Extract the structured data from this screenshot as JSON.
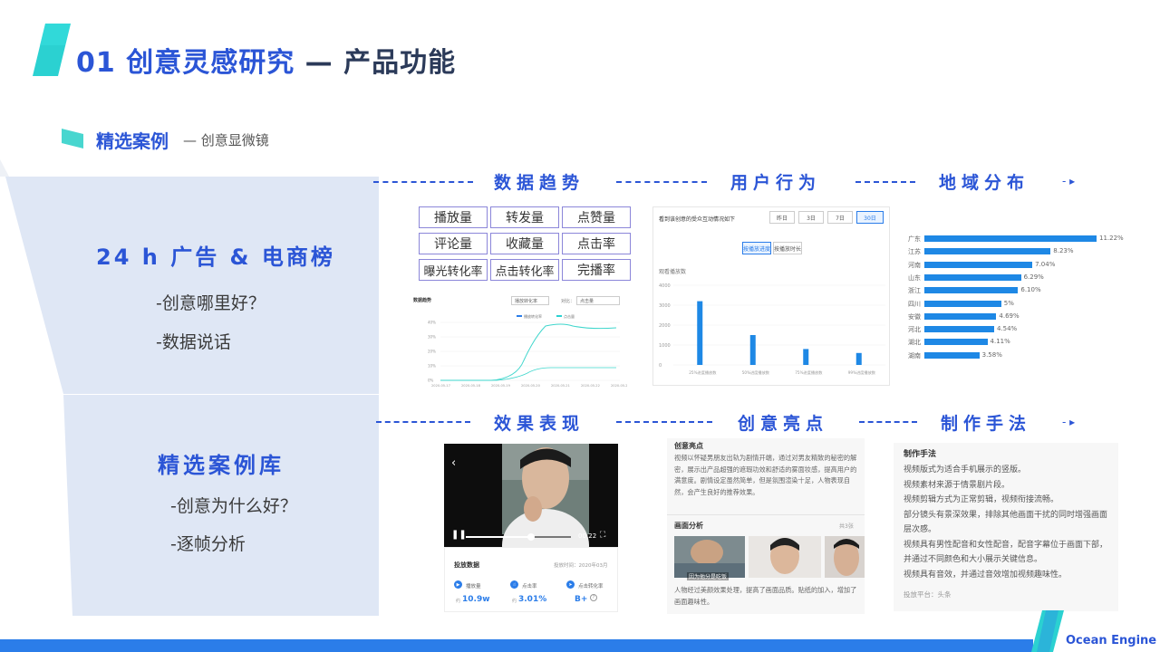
{
  "header": {
    "title_main": "01 创意灵感研究",
    "title_dash": " — ",
    "title_tail": "产品功能"
  },
  "section": {
    "title": "精选案例",
    "subtitle": "— 创意显微镜"
  },
  "left_panels": [
    {
      "title": "24 h 广告 & 电商榜",
      "items": [
        "-创意哪里好？",
        "-数据说话"
      ]
    },
    {
      "title": "精选案例库",
      "items": [
        "-创意为什么好？",
        "-逐帧分析"
      ]
    }
  ],
  "section_heads": {
    "data_trend": "数据趋势",
    "user_behavior": "用户行为",
    "region": "地域分布",
    "effect": "效果表现",
    "highlight": "创意亮点",
    "technique": "制作手法"
  },
  "metrics": [
    "播放量",
    "转发量",
    "点赞量",
    "评论量",
    "收藏量",
    "点击率",
    "曝光转化率",
    "点击转化率",
    "完播率"
  ],
  "trend_chart": {
    "title": "数据趋势",
    "select1": "播放转化率",
    "select2_label": "对比：",
    "select2": "点击量",
    "legend": [
      "播放转化率",
      "点击量"
    ],
    "yticks": [
      "40%",
      "30%",
      "20%",
      "10%",
      "0%"
    ],
    "xticks": [
      "2020-05-17",
      "2020-05-18",
      "2020-05-19",
      "2020-05-20",
      "2020-05-21",
      "2020-05-22",
      "2020-05-23"
    ]
  },
  "behavior_chart": {
    "title": "看到该创意的受众互动情况如下",
    "ranges": [
      "昨日",
      "3日",
      "7日",
      "30日"
    ],
    "active_range": "30日",
    "toggles": [
      "按播放进度",
      "按播放时长"
    ],
    "ylabel": "观看播放数",
    "yticks": [
      "4000",
      "3000",
      "2000",
      "1000",
      "0"
    ],
    "categories": [
      "25%进度播放数",
      "50%进度播放数",
      "75%进度播放数",
      "99%进度播放数"
    ],
    "values": [
      3200,
      1500,
      800,
      600
    ]
  },
  "region_chart": {
    "provinces": [
      "广东",
      "江苏",
      "河南",
      "山东",
      "浙江",
      "四川",
      "安徽",
      "河北",
      "湖北",
      "湖南"
    ],
    "values": [
      "11.22%",
      "8.23%",
      "7.04%",
      "6.29%",
      "6.10%",
      "5%",
      "4.69%",
      "4.54%",
      "4.11%",
      "3.58%"
    ],
    "fractions": [
      1.0,
      0.733,
      0.627,
      0.561,
      0.544,
      0.446,
      0.418,
      0.405,
      0.366,
      0.319
    ]
  },
  "video": {
    "time": "00:22",
    "data_title": "投放数据",
    "data_date": "投放时间：2020年03月",
    "stats": [
      {
        "label": "播放量",
        "prefix": "约",
        "value": "10.9w"
      },
      {
        "label": "点击率",
        "prefix": "约",
        "value": "3.01%"
      },
      {
        "label": "点击转化率",
        "prefix": "",
        "value": "B+"
      }
    ]
  },
  "highlight_card": {
    "title": "创意亮点",
    "text": "视频以怀疑男朋友出轨为剧情开端，通过对男友精致的秘密的解密，展示出产品超强的遮瑕功效和舒适的雾面妆感，提高用户的满意度。剧情设定虽然简单，但是氛围渲染十足，人物表现自然，会产生良好的推荐效果。",
    "frame_title": "画面分析",
    "frame_count": "共3张",
    "frame_caption": "因为他分是吃饭",
    "frame_text": "人物经过美颜效果处理，提高了画面品质。贴纸的加入，增加了画面趣味性。"
  },
  "technique_card": {
    "title": "制作手法",
    "lines": [
      "视频版式为适合手机展示的竖版。",
      "视频素材来源于情景剧片段。",
      "视频剪辑方式为正常剪辑，视频衔接流畅。",
      "部分镜头有景深效果，排除其他画面干扰的同时增强画面层次感。",
      "视频具有男性配音和女性配音，配音字幕位于画面下部，并通过不同颜色和大小展示关键信息。",
      "视频具有音效，并通过音效增加视频趣味性。"
    ],
    "platform": "投放平台：头条"
  },
  "footer": {
    "brand": "Ocean Engine"
  },
  "colors": {
    "primary": "#2b55d6",
    "accent": "#2bd1d1",
    "bar": "#1e88e5",
    "panel": "#dfe7f5"
  }
}
